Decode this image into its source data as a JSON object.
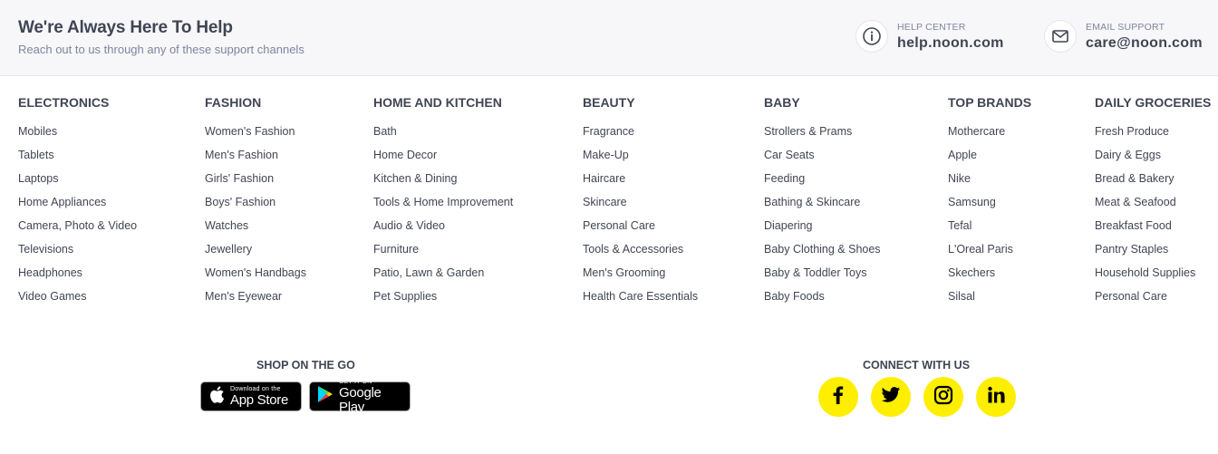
{
  "help": {
    "title": "We're Always Here To Help",
    "subtitle": "Reach out to us through any of these support channels",
    "help_center": {
      "icon": "info-icon",
      "label": "HELP CENTER",
      "value": "help.noon.com"
    },
    "email_support": {
      "icon": "mail-icon",
      "label": "EMAIL SUPPORT",
      "value": "care@noon.com"
    }
  },
  "columns": [
    {
      "heading": "ELECTRONICS",
      "items": [
        "Mobiles",
        "Tablets",
        "Laptops",
        "Home Appliances",
        "Camera, Photo & Video",
        "Televisions",
        "Headphones",
        "Video Games"
      ]
    },
    {
      "heading": "FASHION",
      "items": [
        "Women's Fashion",
        "Men's Fashion",
        "Girls' Fashion",
        "Boys' Fashion",
        "Watches",
        "Jewellery",
        "Women's Handbags",
        "Men's Eyewear"
      ]
    },
    {
      "heading": "HOME AND KITCHEN",
      "items": [
        "Bath",
        "Home Decor",
        "Kitchen & Dining",
        "Tools & Home Improvement",
        "Audio & Video",
        "Furniture",
        "Patio, Lawn & Garden",
        "Pet Supplies"
      ]
    },
    {
      "heading": "BEAUTY",
      "items": [
        "Fragrance",
        "Make-Up",
        "Haircare",
        "Skincare",
        "Personal Care",
        "Tools & Accessories",
        "Men's Grooming",
        "Health Care Essentials"
      ]
    },
    {
      "heading": "BABY",
      "items": [
        "Strollers & Prams",
        "Car Seats",
        "Feeding",
        "Bathing & Skincare",
        "Diapering",
        "Baby Clothing & Shoes",
        "Baby & Toddler Toys",
        "Baby Foods"
      ]
    },
    {
      "heading": "TOP BRANDS",
      "items": [
        "Mothercare",
        "Apple",
        "Nike",
        "Samsung",
        "Tefal",
        "L'Oreal Paris",
        "Skechers",
        "Silsal"
      ]
    },
    {
      "heading": "DAILY GROCERIES",
      "items": [
        "Fresh Produce",
        "Dairy & Eggs",
        "Bread & Bakery",
        "Meat & Seafood",
        "Breakfast Food",
        "Pantry Staples",
        "Household Supplies",
        "Personal Care"
      ]
    }
  ],
  "shop": {
    "title": "SHOP ON THE GO",
    "app_store": {
      "icon": "apple-icon",
      "small": "Download on the",
      "big": "App Store"
    },
    "google_play": {
      "icon": "google-play-icon",
      "small": "GET IT ON",
      "big": "Google Play"
    }
  },
  "connect": {
    "title": "CONNECT WITH US",
    "accent_color": "#feee00",
    "icons": [
      "facebook-icon",
      "twitter-icon",
      "instagram-icon",
      "linkedin-icon"
    ]
  }
}
